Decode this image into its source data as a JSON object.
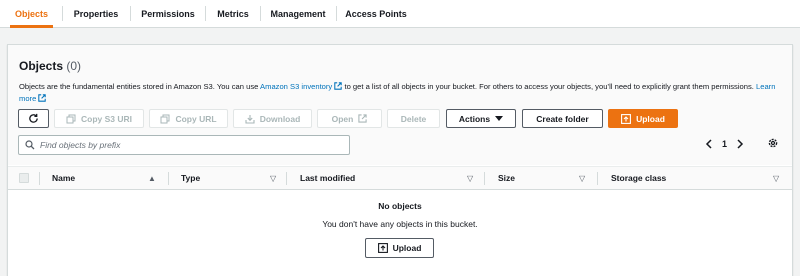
{
  "tabs": [
    {
      "label": "Objects",
      "active": true
    },
    {
      "label": "Properties",
      "active": false
    },
    {
      "label": "Permissions",
      "active": false
    },
    {
      "label": "Metrics",
      "active": false
    },
    {
      "label": "Management",
      "active": false
    },
    {
      "label": "Access Points",
      "active": false
    }
  ],
  "objects": {
    "title": "Objects",
    "count": "(0)",
    "description": {
      "part1": "Objects are the fundamental entities stored in Amazon S3. You can use ",
      "link1": "Amazon S3 inventory",
      "part2": " to get a list of all objects in your bucket. For others to access your objects, you’ll need to explicitly grant them permissions. ",
      "link2": "Learn more"
    }
  },
  "toolbar": {
    "refresh_icon": "refresh-icon",
    "copy_s3_uri": "Copy S3 URI",
    "copy_url": "Copy URL",
    "download": "Download",
    "open": "Open",
    "delete": "Delete",
    "actions": "Actions",
    "create_folder": "Create folder",
    "upload": "Upload"
  },
  "search": {
    "placeholder": "Find objects by prefix",
    "value": ""
  },
  "pagination": {
    "page": "1"
  },
  "table": {
    "columns": [
      "Name",
      "Type",
      "Last modified",
      "Size",
      "Storage class"
    ],
    "empty_title": "No objects",
    "empty_message": "You don't have any objects in this bucket.",
    "empty_upload": "Upload"
  },
  "colors": {
    "accent": "#ec7211",
    "link": "#0073bb"
  }
}
